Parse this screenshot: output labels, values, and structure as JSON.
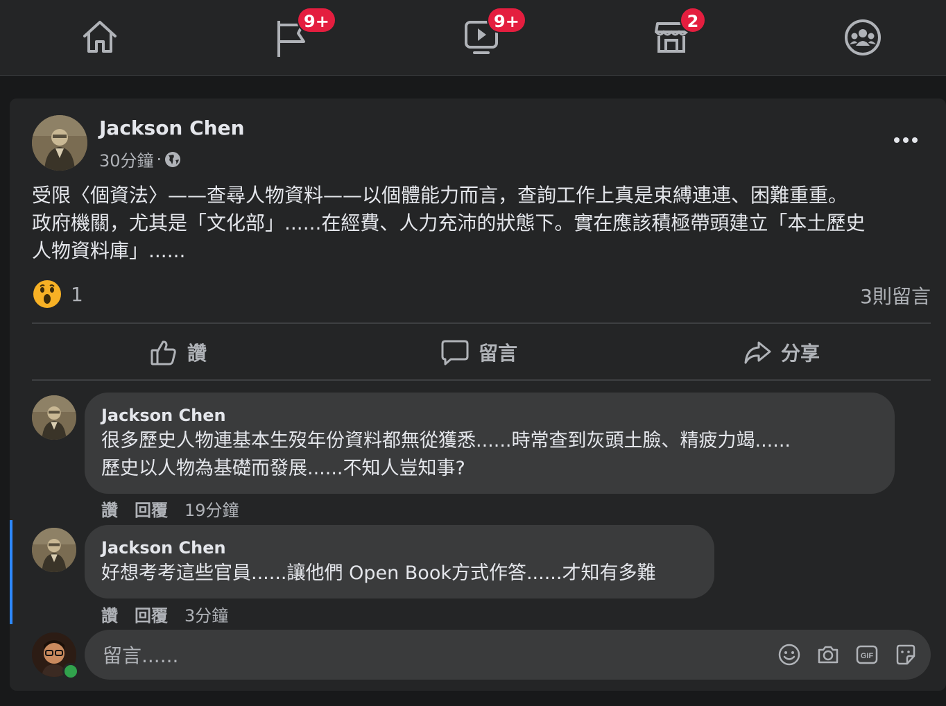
{
  "nav": {
    "items": [
      {
        "name": "home",
        "icon": "home-icon",
        "badge": ""
      },
      {
        "name": "pages",
        "icon": "flag-icon",
        "badge": "9+"
      },
      {
        "name": "watch",
        "icon": "video-icon",
        "badge": "9+"
      },
      {
        "name": "marketplace",
        "icon": "store-icon",
        "badge": "2"
      },
      {
        "name": "groups",
        "icon": "groups-icon",
        "badge": ""
      }
    ],
    "badge_color": "#e41e3f"
  },
  "post": {
    "author": "Jackson Chen",
    "time": "30分鐘",
    "separator": "·",
    "privacy_icon": "globe-icon",
    "text": "受限〈個資法〉——查尋人物資料——以個體能力而言，查詢工作上真是束縛連連、困難重重。\n政府機關，尤其是「文化部」......在經費、人力充沛的狀態下。實在應該積極帶頭建立「本土歷史\n人物資料庫」......",
    "reaction_icon": "wow-reaction-icon",
    "reaction_count": "1",
    "comment_count": "3則留言",
    "actions": {
      "like": "讚",
      "comment": "留言",
      "share": "分享"
    }
  },
  "comments": [
    {
      "author": "Jackson Chen",
      "text": "很多歷史人物連基本生歿年份資料都無從獲悉......時常查到灰頭土臉、精疲力竭......\n歷史以人物為基礎而發展......不知人豈知事?",
      "like": "讚",
      "reply": "回覆",
      "time": "19分鐘"
    },
    {
      "author": "Jackson Chen",
      "text": "好想考考這些官員......讓他們 Open Book方式作答......才知有多難",
      "like": "讚",
      "reply": "回覆",
      "time": "3分鐘"
    }
  ],
  "comment_input": {
    "placeholder": "留言......",
    "icons": [
      "emoji-icon",
      "camera-icon",
      "gif-icon",
      "sticker-icon"
    ]
  },
  "colors": {
    "background": "#18191a",
    "card": "#242526",
    "bubble": "#3a3b3c",
    "accent": "#2d88ff",
    "online": "#31a24c"
  }
}
